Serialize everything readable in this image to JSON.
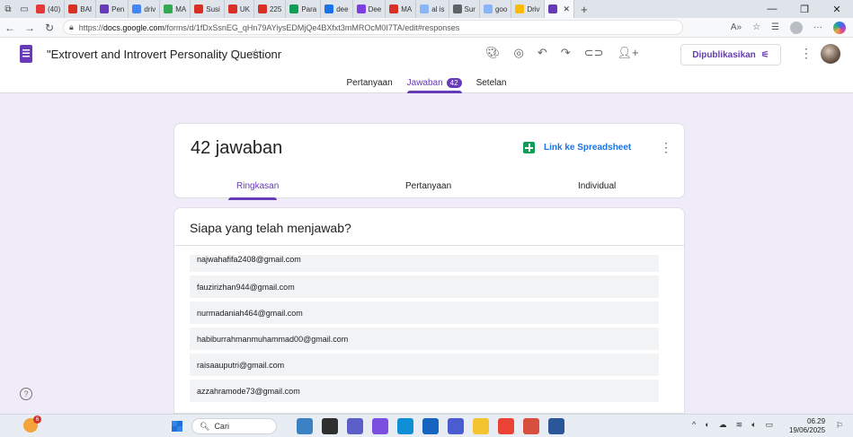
{
  "browser": {
    "tabs": [
      {
        "label": "(40)",
        "color": "#e53935"
      },
      {
        "label": "BAI",
        "color": "#d93025"
      },
      {
        "label": "Pen",
        "color": "#673ab7"
      },
      {
        "label": "driv",
        "color": "#4285f4"
      },
      {
        "label": "MA",
        "color": "#34a853"
      },
      {
        "label": "Susi",
        "color": "#d93025"
      },
      {
        "label": "UK",
        "color": "#d93025"
      },
      {
        "label": "225",
        "color": "#d93025"
      },
      {
        "label": "Para",
        "color": "#0f9d58"
      },
      {
        "label": "dee",
        "color": "#1a73e8"
      },
      {
        "label": "Dee",
        "color": "#7b3fe4"
      },
      {
        "label": "MA",
        "color": "#d93025"
      },
      {
        "label": "al is",
        "color": "#8ab4f8"
      },
      {
        "label": "Sur",
        "color": "#5f6368"
      },
      {
        "label": "goo",
        "color": "#8ab4f8"
      },
      {
        "label": "Driv",
        "color": "#fbbc04"
      }
    ],
    "active_tab_color": "#673ab7",
    "url_prefix": "https://",
    "url_host": "docs.google.com",
    "url_path": "/forms/d/1fDxSsnEG_qHn79AYiysEDMjQe4BXfxt3mMROcM0I7TA/edit#responses"
  },
  "form": {
    "title": "\"Extrovert and Introvert Personality Questionr",
    "publish_label": "Dipublikasikan",
    "tabs": [
      {
        "label": "Pertanyaan",
        "active": false
      },
      {
        "label": "Jawaban",
        "active": true,
        "badge": "42"
      },
      {
        "label": "Setelan",
        "active": false
      }
    ]
  },
  "responses": {
    "count_label": "42 jawaban",
    "sheet_link": "Link ke Spreadsheet",
    "subtabs": [
      "Ringkasan",
      "Pertanyaan",
      "Individual"
    ],
    "section_title": "Siapa yang telah menjawab?",
    "emails": [
      "najwahafifa2408@gmail.com",
      "fauzirizhan944@gmail.com",
      "nurmadaniah464@gmail.com",
      "habiburrahmanmuhammad00@gmail.com",
      "raisaauputri@gmail.com",
      "azzahramode73@gmail.com"
    ]
  },
  "taskbar": {
    "search_placeholder": "Cari",
    "weather_badge": "6",
    "time": "06.29",
    "date": "19/06/2025",
    "apps": [
      {
        "name": "landscape-app",
        "color": "#3b82c4"
      },
      {
        "name": "task-view",
        "color": "#2f2f2f"
      },
      {
        "name": "teams",
        "color": "#5b5fc7"
      },
      {
        "name": "copilot",
        "color": "#7b4fe0"
      },
      {
        "name": "edge",
        "color": "#0f8fd6"
      },
      {
        "name": "store",
        "color": "#1565c0"
      },
      {
        "name": "word-like",
        "color": "#4a5cd0"
      },
      {
        "name": "file-explorer",
        "color": "#f4c430"
      },
      {
        "name": "chrome",
        "color": "#ea4335"
      },
      {
        "name": "calendar",
        "color": "#d94f3d"
      },
      {
        "name": "word",
        "color": "#2b579a"
      }
    ]
  }
}
